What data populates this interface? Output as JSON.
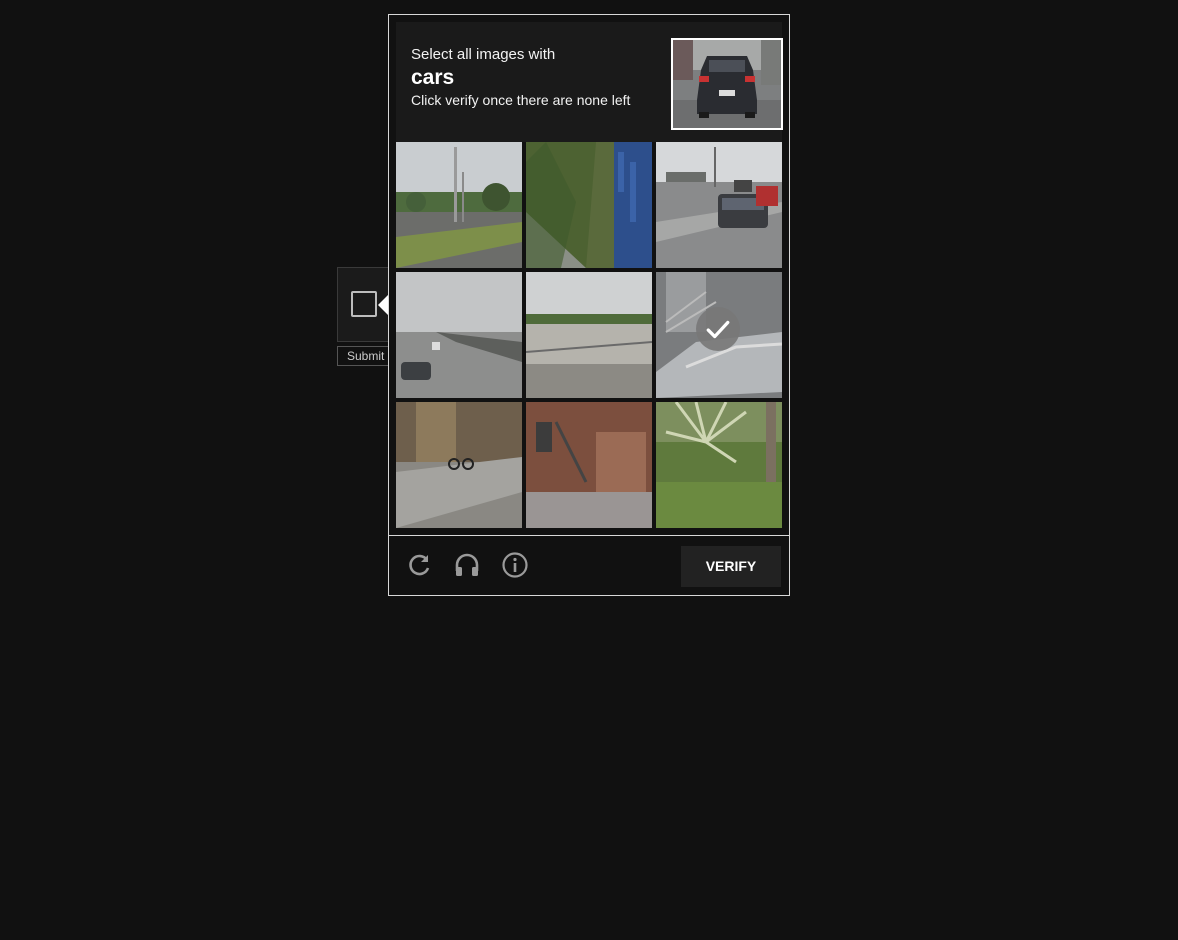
{
  "widget": {
    "submit_label": "Submit"
  },
  "challenge": {
    "prompt_line1": "Select all images with",
    "target": "cars",
    "prompt_line2": "Click verify once there are none left",
    "example_icon": "car-rear-photo",
    "tiles": [
      {
        "content": "roadside-park-with-poles",
        "selected": false
      },
      {
        "content": "grass-and-blue-bin",
        "selected": false
      },
      {
        "content": "road-with-cars",
        "selected": false
      },
      {
        "content": "highway-with-car",
        "selected": false
      },
      {
        "content": "beach-shoreline",
        "selected": false
      },
      {
        "content": "parked-car-near-stairs",
        "selected": true
      },
      {
        "content": "sidewalk-with-bicycle",
        "selected": false
      },
      {
        "content": "brick-building-with-stairs",
        "selected": false
      },
      {
        "content": "palm-plant-on-grass",
        "selected": false
      }
    ]
  },
  "footer": {
    "refresh_icon": "refresh-icon",
    "audio_icon": "headphones-icon",
    "info_icon": "info-icon",
    "verify_label": "VERIFY"
  },
  "colors": {
    "background": "#111111",
    "panel": "#1a1a1a",
    "border": "#d8d8d8",
    "button": "#222222"
  }
}
